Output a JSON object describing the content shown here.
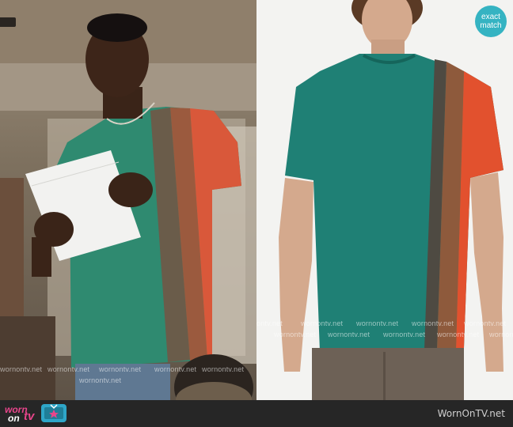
{
  "badge": {
    "line1": "exact",
    "line2": "match"
  },
  "footer": {
    "logo_worn": "worn",
    "logo_on": "on",
    "logo_tv": "tv",
    "site": "WornOnTV.net"
  },
  "watermarks": {
    "left": [
      "wornontv.net",
      "wornontv.net",
      "wornontv.net",
      "wornontv.net",
      "wornontv.net",
      "wornontv.net"
    ],
    "right": [
      "ontv.net",
      "wornontv.net",
      "wornontv.net",
      "wornontv.net",
      "wornontv.net",
      "wornontv.net",
      "wornontv.net",
      "wornontv.net",
      "wornontv.net",
      "wornontv.net"
    ]
  },
  "colors": {
    "pink": "#e8458b",
    "badge": "#35b3c2",
    "teal_tee": "#1f8075",
    "orange": "#e2512e",
    "footer": "#262626"
  }
}
